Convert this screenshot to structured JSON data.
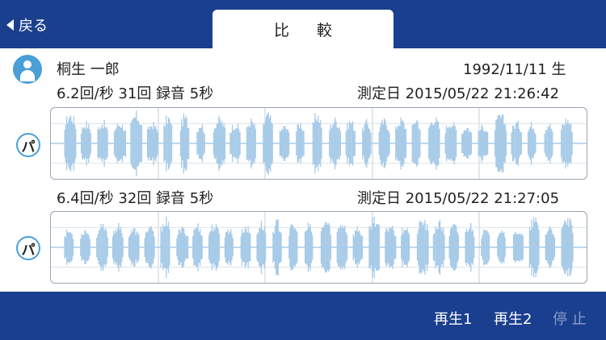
{
  "header": {
    "back_label": "戻る",
    "tab_label": "比 較"
  },
  "user": {
    "name": "桐生 一郎",
    "birth": "1992/11/11 生"
  },
  "recordings": [
    {
      "summary": "6.2回/秒 31回 録音 5秒",
      "date": "測定日 2015/05/22 21:26:42",
      "pa_label": "パ"
    },
    {
      "summary": "6.4回/秒 32回 録音 5秒",
      "date": "測定日 2015/05/22 21:27:05",
      "pa_label": "パ"
    }
  ],
  "controls": {
    "play1": "再生1",
    "play2": "再生2",
    "stop": "停 止"
  },
  "colors": {
    "bar": "#1a3f8f",
    "wave": "#a8cbe8",
    "accent": "#4a9fd8"
  }
}
